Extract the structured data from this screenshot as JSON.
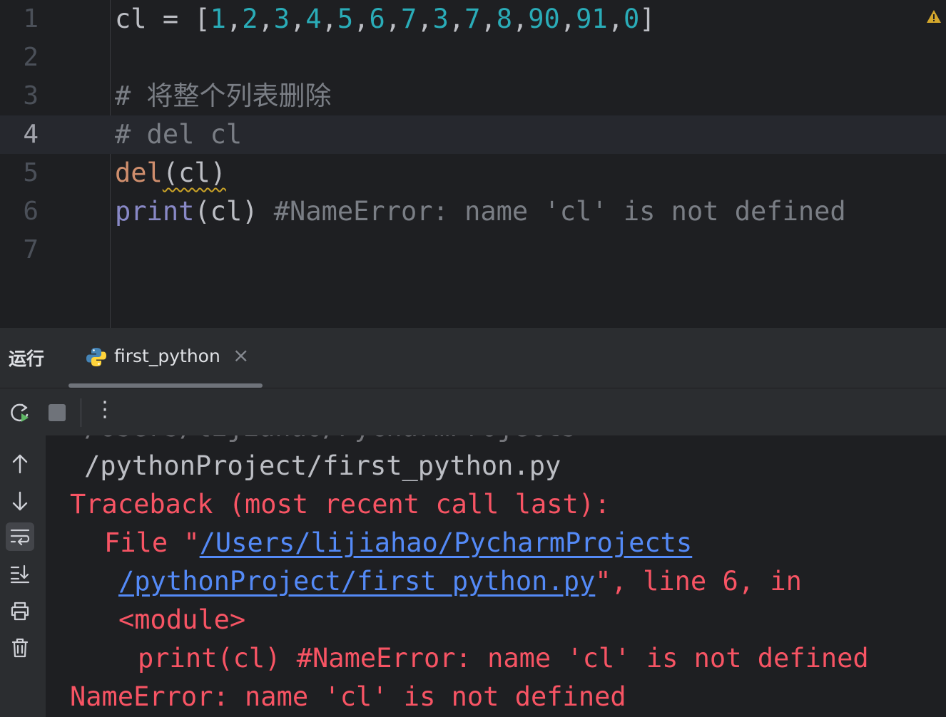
{
  "editor": {
    "lines": [
      {
        "num": "1",
        "tokens": [
          {
            "t": "cl = [",
            "c": "plain"
          },
          {
            "t": "1",
            "c": "num"
          },
          {
            "t": ",",
            "c": "plain"
          },
          {
            "t": "2",
            "c": "num"
          },
          {
            "t": ",",
            "c": "plain"
          },
          {
            "t": "3",
            "c": "num"
          },
          {
            "t": ",",
            "c": "plain"
          },
          {
            "t": "4",
            "c": "num"
          },
          {
            "t": ",",
            "c": "plain"
          },
          {
            "t": "5",
            "c": "num"
          },
          {
            "t": ",",
            "c": "plain"
          },
          {
            "t": "6",
            "c": "num"
          },
          {
            "t": ",",
            "c": "plain"
          },
          {
            "t": "7",
            "c": "num"
          },
          {
            "t": ",",
            "c": "plain"
          },
          {
            "t": "3",
            "c": "num"
          },
          {
            "t": ",",
            "c": "plain"
          },
          {
            "t": "7",
            "c": "num"
          },
          {
            "t": ",",
            "c": "plain"
          },
          {
            "t": "8",
            "c": "num"
          },
          {
            "t": ",",
            "c": "plain"
          },
          {
            "t": "90",
            "c": "num"
          },
          {
            "t": ",",
            "c": "plain"
          },
          {
            "t": "91",
            "c": "num"
          },
          {
            "t": ",",
            "c": "plain"
          },
          {
            "t": "0",
            "c": "num"
          },
          {
            "t": "]",
            "c": "plain"
          }
        ]
      },
      {
        "num": "2",
        "tokens": []
      },
      {
        "num": "3",
        "tokens": [
          {
            "t": "# 将整个列表删除",
            "c": "comment"
          }
        ]
      },
      {
        "num": "4",
        "tokens": [
          {
            "t": "# del cl",
            "c": "comment"
          }
        ],
        "current": true
      },
      {
        "num": "5",
        "tokens": [
          {
            "t": "del",
            "c": "kw"
          },
          {
            "t": "(cl)",
            "c": "plain",
            "squiggle": true
          }
        ]
      },
      {
        "num": "6",
        "tokens": [
          {
            "t": "print",
            "c": "builtin"
          },
          {
            "t": "(cl) ",
            "c": "plain"
          },
          {
            "t": "#NameError: name 'cl' is not defined",
            "c": "comment"
          }
        ]
      },
      {
        "num": "7",
        "tokens": []
      }
    ],
    "warning_icon": "warning-triangle-icon"
  },
  "run_panel": {
    "title": "运行",
    "tab_label": "first_python",
    "tab_close": "×",
    "toolbar": {
      "rerun_icon": "rerun-icon",
      "stop_icon": "stop-icon",
      "more_label": "⋮"
    },
    "side_icons": [
      "arrow-up-icon",
      "arrow-down-icon",
      "soft-wrap-icon",
      "scroll-to-end-icon",
      "print-icon",
      "trash-icon"
    ],
    "console": {
      "partial_top": "/Users/lijiahao/PycharmProjects",
      "path_line": "/pythonProject/first_python.py",
      "traceback": "Traceback (most recent call last):",
      "file_prefix": "File \"",
      "file_link_1": "/Users/lijiahao/PycharmProjects",
      "file_link_2": "/pythonProject/first_python.py",
      "file_suffix": "\", line 6, in",
      "module": "<module>",
      "code_line": "print(cl) #NameError: name 'cl' is not defined",
      "error": "NameError: name 'cl' is not defined"
    }
  },
  "colors": {
    "background": "#1e1f22",
    "number": "#2aacb8",
    "keyword": "#cf8e6d",
    "builtin": "#8888c6",
    "comment": "#7a7e85",
    "error": "#f75464",
    "link": "#548af7"
  }
}
